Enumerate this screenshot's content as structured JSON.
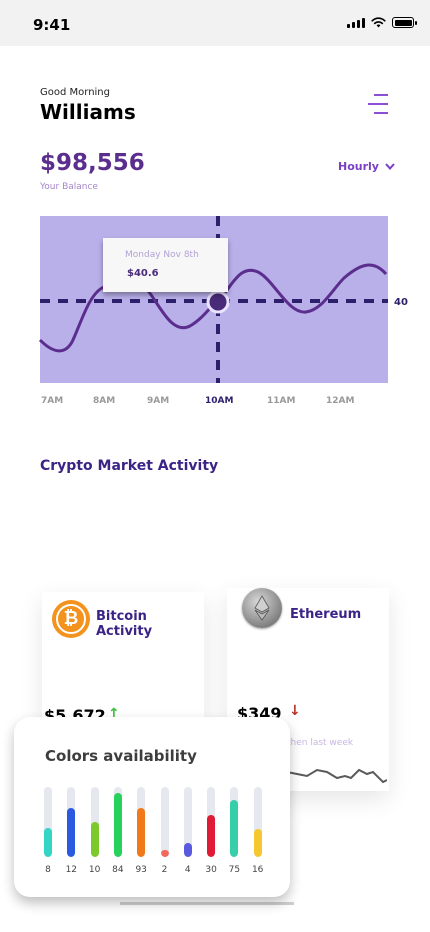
{
  "status": {
    "time": "9:41"
  },
  "header": {
    "greeting": "Good Morning",
    "name": "Williams"
  },
  "balance": {
    "amount": "$98,556",
    "label": "Your Balance",
    "period": "Hourly"
  },
  "chart": {
    "tooltip_date": "Monday Nov 8th",
    "tooltip_value": "$40.6",
    "level_label": "40",
    "times": [
      "7AM",
      "8AM",
      "9AM",
      "10AM",
      "11AM",
      "12AM"
    ],
    "active_time": "10AM",
    "colors": {
      "background": "#b9b0ea",
      "line": "#5b2e8e",
      "guides": "#2d1f6b"
    }
  },
  "section": {
    "title": "Crypto Market Activity"
  },
  "bitcoin": {
    "title": "Bitcoin Activity",
    "price": "$5,672",
    "trend": "up",
    "coin_symbol": "₿"
  },
  "ethereum": {
    "title": "Ethereum",
    "price": "$349",
    "trend": "down",
    "compare": "then last week"
  },
  "colors_availability": {
    "title": "Colors availability",
    "bars": [
      {
        "label": "8",
        "value": 0.42,
        "color": "#33d6c6"
      },
      {
        "label": "12",
        "value": 0.7,
        "color": "#2b59e0"
      },
      {
        "label": "10",
        "value": 0.5,
        "color": "#7cc92b"
      },
      {
        "label": "84",
        "value": 0.92,
        "color": "#27d15b"
      },
      {
        "label": "93",
        "value": 0.7,
        "color": "#f07a1a"
      },
      {
        "label": "2",
        "value": 0.1,
        "color": "#f06a5a"
      },
      {
        "label": "4",
        "value": 0.2,
        "color": "#5a5ae0"
      },
      {
        "label": "30",
        "value": 0.6,
        "color": "#e01b35"
      },
      {
        "label": "75",
        "value": 0.82,
        "color": "#37cfa8"
      },
      {
        "label": "16",
        "value": 0.4,
        "color": "#f7c730"
      }
    ]
  }
}
